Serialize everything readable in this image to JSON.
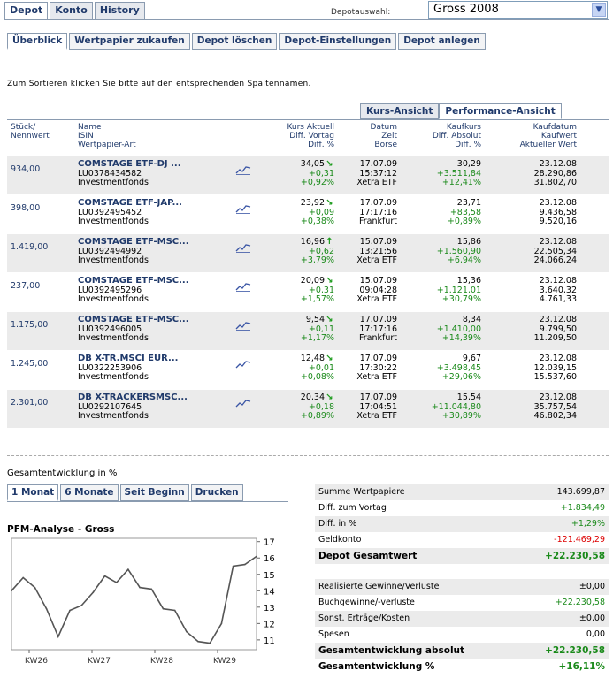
{
  "nav": {
    "tabs": [
      "Depot",
      "Konto",
      "History"
    ]
  },
  "depot": {
    "label": "Depotauswahl:",
    "selected": "Gross 2008"
  },
  "subnav": {
    "tabs": [
      "Überblick",
      "Wertpapier zukaufen",
      "Depot löschen",
      "Depot-Einstellungen",
      "Depot anlegen"
    ]
  },
  "hint": "Zum Sortieren klicken Sie bitte auf den entsprechenden Spaltennamen.",
  "view": {
    "tabs": [
      "Kurs-Ansicht",
      "Performance-Ansicht"
    ]
  },
  "columns": {
    "qty": [
      "Stück/",
      "Nennwert"
    ],
    "name": [
      "Name",
      "ISIN",
      "Wertpapier-Art"
    ],
    "kurs": [
      "Kurs Aktuell",
      "Diff. Vortag",
      "Diff. %"
    ],
    "datum": [
      "Datum",
      "Zeit",
      "Börse"
    ],
    "kaufkurs": [
      "Kaufkurs",
      "Diff. Absolut",
      "Diff. %"
    ],
    "kaufdatum": [
      "Kaufdatum",
      "Kaufwert",
      "Aktueller Wert"
    ]
  },
  "rows": [
    {
      "qty": "934,00",
      "name": "COMSTAGE ETF-DJ ...",
      "isin": "LU0378434582",
      "art": "Investmentfonds",
      "kurs": "34,05",
      "trend": "down",
      "diff": "+0,31",
      "diffp": "+0,92%",
      "datum": "17.07.09",
      "zeit": "15:37:12",
      "boerse": "Xetra ETF",
      "kaufkurs": "30,29",
      "kabs": "+3.511,84",
      "kproz": "+12,41%",
      "kaufdatum": "23.12.08",
      "kaufwert": "28.290,86",
      "wert": "31.802,70"
    },
    {
      "qty": "398,00",
      "name": "COMSTAGE ETF-JAP...",
      "isin": "LU0392495452",
      "art": "Investmentfonds",
      "kurs": "23,92",
      "trend": "down",
      "diff": "+0,09",
      "diffp": "+0,38%",
      "datum": "17.07.09",
      "zeit": "17:17:16",
      "boerse": "Frankfurt",
      "kaufkurs": "23,71",
      "kabs": "+83,58",
      "kproz": "+0,89%",
      "kaufdatum": "23.12.08",
      "kaufwert": "9.436,58",
      "wert": "9.520,16"
    },
    {
      "qty": "1.419,00",
      "name": "COMSTAGE ETF-MSC...",
      "isin": "LU0392494992",
      "art": "Investmentfonds",
      "kurs": "16,96",
      "trend": "up",
      "diff": "+0,62",
      "diffp": "+3,79%",
      "datum": "15.07.09",
      "zeit": "13:21:56",
      "boerse": "Xetra ETF",
      "kaufkurs": "15,86",
      "kabs": "+1.560,90",
      "kproz": "+6,94%",
      "kaufdatum": "23.12.08",
      "kaufwert": "22.505,34",
      "wert": "24.066,24"
    },
    {
      "qty": "237,00",
      "name": "COMSTAGE ETF-MSC...",
      "isin": "LU0392495296",
      "art": "Investmentfonds",
      "kurs": "20,09",
      "trend": "down",
      "diff": "+0,31",
      "diffp": "+1,57%",
      "datum": "15.07.09",
      "zeit": "09:04:28",
      "boerse": "Xetra ETF",
      "kaufkurs": "15,36",
      "kabs": "+1.121,01",
      "kproz": "+30,79%",
      "kaufdatum": "23.12.08",
      "kaufwert": "3.640,32",
      "wert": "4.761,33"
    },
    {
      "qty": "1.175,00",
      "name": "COMSTAGE ETF-MSC...",
      "isin": "LU0392496005",
      "art": "Investmentfonds",
      "kurs": "9,54",
      "trend": "down",
      "diff": "+0,11",
      "diffp": "+1,17%",
      "datum": "17.07.09",
      "zeit": "17:17:16",
      "boerse": "Frankfurt",
      "kaufkurs": "8,34",
      "kabs": "+1.410,00",
      "kproz": "+14,39%",
      "kaufdatum": "23.12.08",
      "kaufwert": "9.799,50",
      "wert": "11.209,50"
    },
    {
      "qty": "1.245,00",
      "name": "DB X-TR.MSCI EUR...",
      "isin": "LU0322253906",
      "art": "Investmentfonds",
      "kurs": "12,48",
      "trend": "down",
      "diff": "+0,01",
      "diffp": "+0,08%",
      "datum": "17.07.09",
      "zeit": "17:30:22",
      "boerse": "Xetra ETF",
      "kaufkurs": "9,67",
      "kabs": "+3.498,45",
      "kproz": "+29,06%",
      "kaufdatum": "23.12.08",
      "kaufwert": "12.039,15",
      "wert": "15.537,60"
    },
    {
      "qty": "2.301,00",
      "name": "DB X-TRACKERSMSC...",
      "isin": "LU0292107645",
      "art": "Investmentfonds",
      "kurs": "20,34",
      "trend": "down",
      "diff": "+0,18",
      "diffp": "+0,89%",
      "datum": "17.07.09",
      "zeit": "17:04:51",
      "boerse": "Xetra ETF",
      "kaufkurs": "15,54",
      "kabs": "+11.044,80",
      "kproz": "+30,89%",
      "kaufdatum": "23.12.08",
      "kaufwert": "35.757,54",
      "wert": "46.802,34"
    }
  ],
  "gesamt": {
    "title": "Gesamtentwicklung in %",
    "tabs": [
      "1 Monat",
      "6 Monate",
      "Seit Beginn",
      "Drucken"
    ],
    "chart_title": "PFM-Analyse - Gross"
  },
  "summary": {
    "block1": [
      {
        "label": "Summe Wertpapiere",
        "value": "143.699,87",
        "tone": "plain",
        "bold": false
      },
      {
        "label": "Diff. zum Vortag",
        "value": "+1.834,49",
        "tone": "pos",
        "bold": false
      },
      {
        "label": "Diff. in %",
        "value": "+1,29%",
        "tone": "pos",
        "bold": false
      },
      {
        "label": "Geldkonto",
        "value": "-121.469,29",
        "tone": "neg",
        "bold": false
      },
      {
        "label": "Depot Gesamtwert",
        "value": "+22.230,58",
        "tone": "pos",
        "bold": true
      }
    ],
    "block2": [
      {
        "label": "Realisierte Gewinne/Verluste",
        "value": "±0,00",
        "tone": "plain",
        "bold": false
      },
      {
        "label": "Buchgewinne/-verluste",
        "value": "+22.230,58",
        "tone": "pos",
        "bold": false
      },
      {
        "label": "Sonst. Erträge/Kosten",
        "value": "±0,00",
        "tone": "plain",
        "bold": false
      },
      {
        "label": "Spesen",
        "value": "0,00",
        "tone": "plain",
        "bold": false
      },
      {
        "label": "Gesamtentwicklung absolut",
        "value": "+22.230,58",
        "tone": "pos",
        "bold": true
      },
      {
        "label": "Gesamtentwicklung %",
        "value": "+16,11%",
        "tone": "pos",
        "bold": true
      }
    ]
  },
  "chart_data": {
    "type": "line",
    "title": "PFM-Analyse - Gross",
    "x_ticks": [
      "KW26",
      "KW27",
      "KW28",
      "KW29"
    ],
    "y_ticks": [
      11,
      12,
      13,
      14,
      15,
      16,
      17
    ],
    "ylim": [
      10.4,
      17.2
    ],
    "series": [
      {
        "values": [
          14.0,
          14.8,
          14.2,
          12.9,
          11.2,
          12.8,
          13.1,
          13.9,
          14.9,
          14.5,
          15.3,
          14.2,
          14.1,
          12.9,
          12.8,
          11.5,
          10.9,
          10.8,
          12.0,
          15.5,
          15.6,
          16.1
        ]
      }
    ],
    "grid": false,
    "line_color": "#555555"
  }
}
